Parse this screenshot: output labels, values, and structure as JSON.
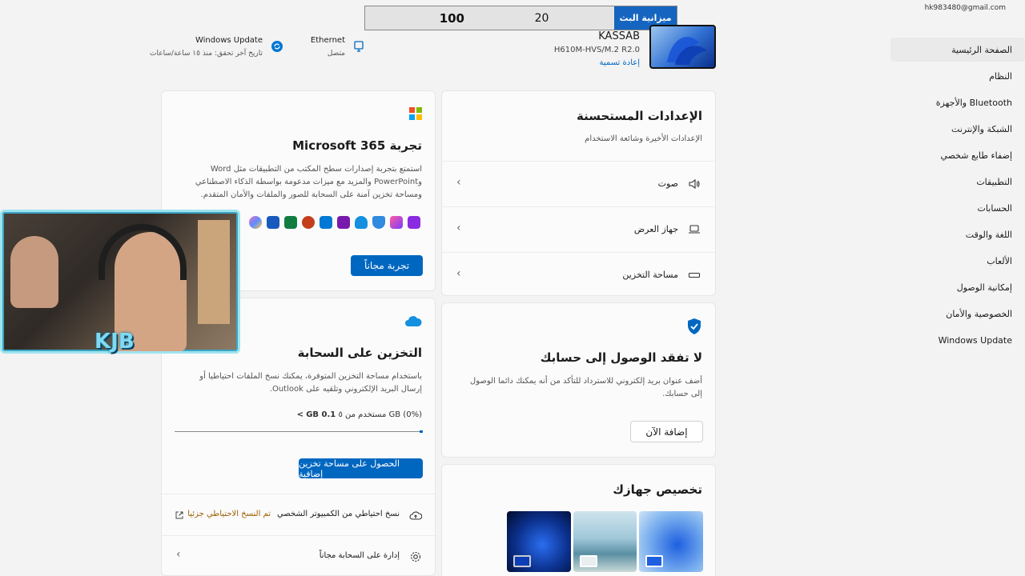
{
  "account": {
    "email": "hk983480@gmail.com"
  },
  "overlay": {
    "label": "ميزانية البث",
    "value1": "20",
    "value2": "100"
  },
  "device": {
    "name": "KASSAB",
    "model": "H610M-HVS/M.2 R2.0",
    "rename": "إعادة تسمية"
  },
  "status": {
    "ethernet_title": "Ethernet",
    "ethernet_sub": "متصل",
    "update_title": "Windows Update",
    "update_sub": "تاريخ آخر تحقق: منذ ١٥ ساعة/ساعات"
  },
  "sidebar": {
    "items": [
      {
        "label": "الصفحة الرئيسية"
      },
      {
        "label": "النظام"
      },
      {
        "label": "Bluetooth والأجهزة"
      },
      {
        "label": "الشبكة والإنترنت"
      },
      {
        "label": "إضفاء طابع شخصي"
      },
      {
        "label": "التطبيقات"
      },
      {
        "label": "الحسابات"
      },
      {
        "label": "اللغة والوقت"
      },
      {
        "label": "الألعاب"
      },
      {
        "label": "إمكانية الوصول"
      },
      {
        "label": "الخصوصية والأمان"
      },
      {
        "label": "Windows Update"
      }
    ]
  },
  "recommended": {
    "title": "الإعدادات المستحسنة",
    "subtitle": "الإعدادات الأخيرة وشائعة الاستخدام",
    "rows": [
      {
        "label": "صوت"
      },
      {
        "label": "جهاز العرض"
      },
      {
        "label": "مساحة التخزين"
      }
    ]
  },
  "account_card": {
    "title": "لا تفقد الوصول إلى حسابك",
    "body": "أضف عنوان بريد إلكتروني للاسترداد للتأكد من أنه يمكنك دائما الوصول إلى حسابك.",
    "button": "إضافة الآن"
  },
  "personalize": {
    "title": "تخصيص جهازك"
  },
  "m365": {
    "title": "تجربة Microsoft 365",
    "body": "استمتع بتجربة إصدارات سطح المكتب من التطبيقات مثل Word وPowerPoint والمزيد مع ميزات مدعومة بواسطة الذكاء الاصطناعي ومساحة تخزين آمنة على السحابة للصور والملفات والأمان المتقدم.",
    "button": "تجربة مجاناً"
  },
  "cloud": {
    "title": "التخزين على السحابة",
    "body": "باستخدام مساحة التخزين المتوفرة، يمكنك نسخ الملفات احتياطيا أو إرسال البريد الإلكتروني وتلقيه على Outlook.",
    "usage_main": "0.1 GB",
    "usage_rest": "(0%) GB مستخدم من ٥",
    "usage_gt": ">",
    "usage_fraction": 0.01,
    "button": "الحصول على مساحة تخزين إضافية",
    "backup_label": "نسخ احتياطي من الكمبيوتر الشخصي",
    "backup_status": "تم النسخ الاحتياطي جزئيا",
    "manage_label": "إدارة على السحابة مجاناً"
  },
  "colors": {
    "accent": "#0067c0",
    "warning_text": "#9d5d00"
  }
}
